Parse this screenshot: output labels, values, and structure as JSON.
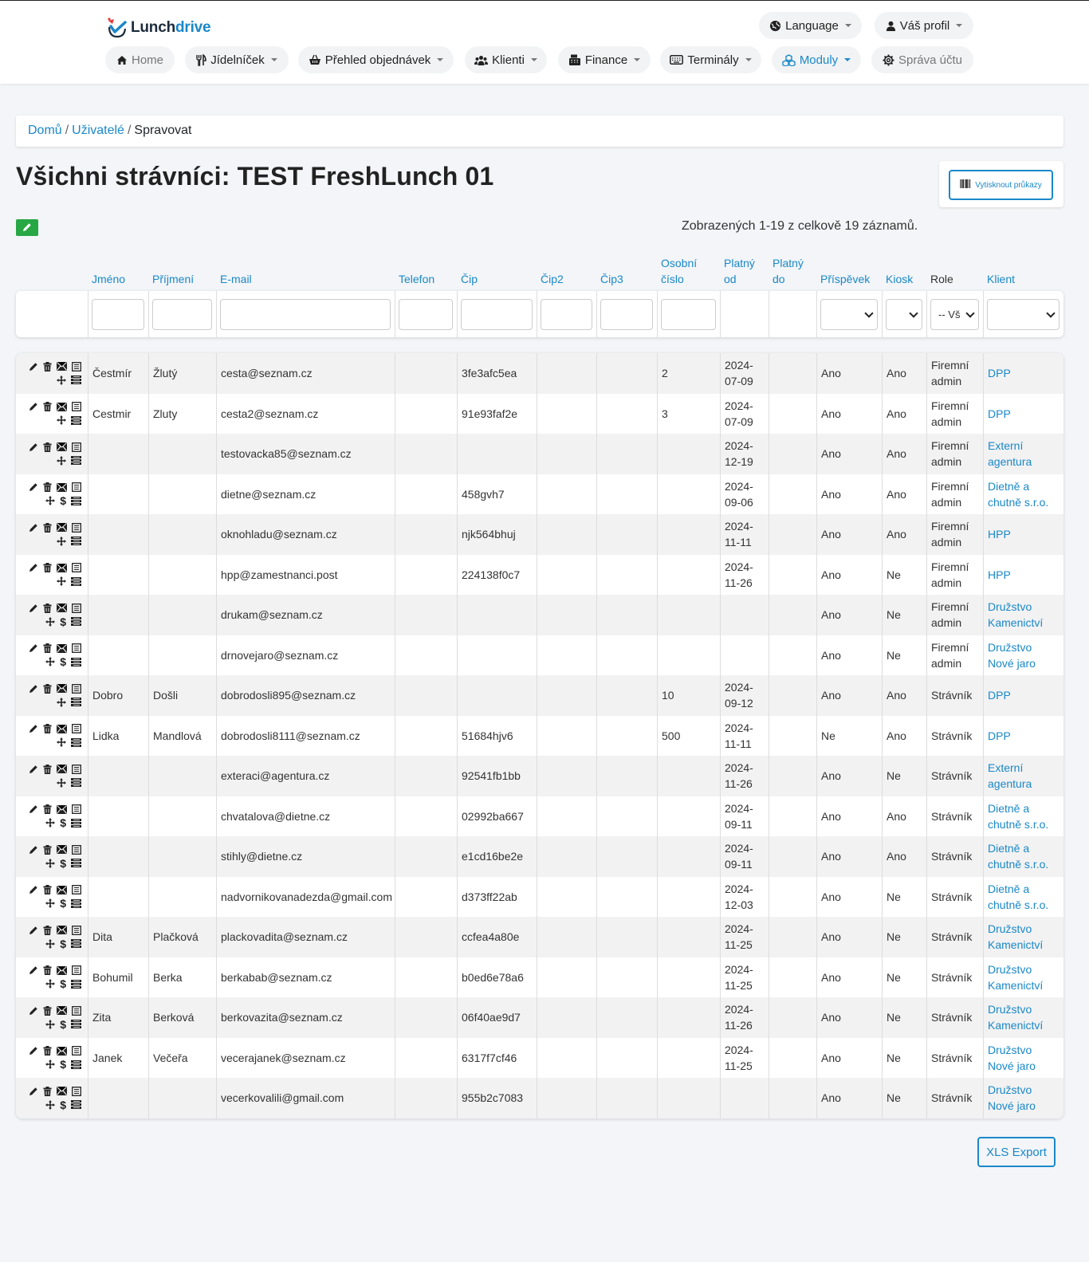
{
  "brand": {
    "name_part1": "Lunch",
    "name_part2": "drive"
  },
  "top_right": {
    "language": "Language",
    "profile": "Váš profil"
  },
  "nav": [
    {
      "label": "Home",
      "icon": "home-icon",
      "dropdown": false,
      "style": "muted"
    },
    {
      "label": "Jídelníček",
      "icon": "utensils-icon",
      "dropdown": true,
      "style": "normal"
    },
    {
      "label": "Přehled objednávek",
      "icon": "basket-icon",
      "dropdown": true,
      "style": "normal"
    },
    {
      "label": "Klienti",
      "icon": "users-icon",
      "dropdown": true,
      "style": "normal"
    },
    {
      "label": "Finance",
      "icon": "cash-register-icon",
      "dropdown": true,
      "style": "normal"
    },
    {
      "label": "Terminály",
      "icon": "keyboard-icon",
      "dropdown": true,
      "style": "normal"
    },
    {
      "label": "Moduly",
      "icon": "cubes-icon",
      "dropdown": true,
      "style": "accent"
    },
    {
      "label": "Správa účtu",
      "icon": "gear-icon",
      "dropdown": false,
      "style": "muted"
    }
  ],
  "breadcrumb": {
    "home": "Domů",
    "users": "Uživatelé",
    "current": "Spravovat",
    "separator": "/"
  },
  "page": {
    "title": "Všichni strávníci: TEST FreshLunch 01",
    "print_button": "Vytisknout průkazy",
    "summary": "Zobrazených 1-19 z celkově 19 záznamů.",
    "xls_export": "XLS Export"
  },
  "columns": [
    {
      "key": "first_name",
      "label": "Jméno",
      "sortable": true
    },
    {
      "key": "last_name",
      "label": "Příjmení",
      "sortable": true
    },
    {
      "key": "email",
      "label": "E-mail",
      "sortable": true
    },
    {
      "key": "phone",
      "label": "Telefon",
      "sortable": true
    },
    {
      "key": "chip",
      "label": "Čip",
      "sortable": true
    },
    {
      "key": "chip2",
      "label": "Čip2",
      "sortable": true
    },
    {
      "key": "chip3",
      "label": "Čip3",
      "sortable": true
    },
    {
      "key": "personal_no",
      "label": "Osobní číslo",
      "sortable": true
    },
    {
      "key": "valid_from",
      "label": "Platný od",
      "sortable": true
    },
    {
      "key": "valid_to",
      "label": "Platný do",
      "sortable": true
    },
    {
      "key": "contribution",
      "label": "Příspěvek",
      "sortable": true
    },
    {
      "key": "kiosk",
      "label": "Kiosk",
      "sortable": true
    },
    {
      "key": "role",
      "label": "Role",
      "sortable": false
    },
    {
      "key": "client",
      "label": "Klient",
      "sortable": true
    }
  ],
  "filters": {
    "role_selected": "-- Vš"
  },
  "rows": [
    {
      "first_name": "Čestmír",
      "last_name": "Žlutý",
      "email": "cesta@seznam.cz",
      "phone": "",
      "chip": "3fe3afc5ea",
      "chip2": "",
      "chip3": "",
      "personal_no": "2",
      "valid_from": "2024-07-09",
      "valid_to": "",
      "contribution": "Ano",
      "kiosk": "Ano",
      "role": "Firemní admin",
      "client": "DPP",
      "has_dollar": false
    },
    {
      "first_name": "Cestmir",
      "last_name": "Zluty",
      "email": "cesta2@seznam.cz",
      "phone": "",
      "chip": "91e93faf2e",
      "chip2": "",
      "chip3": "",
      "personal_no": "3",
      "valid_from": "2024-07-09",
      "valid_to": "",
      "contribution": "Ano",
      "kiosk": "Ano",
      "role": "Firemní admin",
      "client": "DPP",
      "has_dollar": false
    },
    {
      "first_name": "",
      "last_name": "",
      "email": "testovacka85@seznam.cz",
      "phone": "",
      "chip": "",
      "chip2": "",
      "chip3": "",
      "personal_no": "",
      "valid_from": "2024-12-19",
      "valid_to": "",
      "contribution": "Ano",
      "kiosk": "Ano",
      "role": "Firemní admin",
      "client": "Externí agentura",
      "has_dollar": false
    },
    {
      "first_name": "",
      "last_name": "",
      "email": "dietne@seznam.cz",
      "phone": "",
      "chip": "458gvh7",
      "chip2": "",
      "chip3": "",
      "personal_no": "",
      "valid_from": "2024-09-06",
      "valid_to": "",
      "contribution": "Ano",
      "kiosk": "Ano",
      "role": "Firemní admin",
      "client": "Dietně a chutně s.r.o.",
      "has_dollar": true
    },
    {
      "first_name": "",
      "last_name": "",
      "email": "oknohladu@seznam.cz",
      "phone": "",
      "chip": "njk564bhuj",
      "chip2": "",
      "chip3": "",
      "personal_no": "",
      "valid_from": "2024-11-11",
      "valid_to": "",
      "contribution": "Ano",
      "kiosk": "Ano",
      "role": "Firemní admin",
      "client": "HPP",
      "has_dollar": false
    },
    {
      "first_name": "",
      "last_name": "",
      "email": "hpp@zamestnanci.post",
      "phone": "",
      "chip": "224138f0c7",
      "chip2": "",
      "chip3": "",
      "personal_no": "",
      "valid_from": "2024-11-26",
      "valid_to": "",
      "contribution": "Ano",
      "kiosk": "Ne",
      "role": "Firemní admin",
      "client": "HPP",
      "has_dollar": false
    },
    {
      "first_name": "",
      "last_name": "",
      "email": "drukam@seznam.cz",
      "phone": "",
      "chip": "",
      "chip2": "",
      "chip3": "",
      "personal_no": "",
      "valid_from": "",
      "valid_to": "",
      "contribution": "Ano",
      "kiosk": "Ne",
      "role": "Firemní admin",
      "client": "Družstvo Kamenictví",
      "has_dollar": true
    },
    {
      "first_name": "",
      "last_name": "",
      "email": "drnovejaro@seznam.cz",
      "phone": "",
      "chip": "",
      "chip2": "",
      "chip3": "",
      "personal_no": "",
      "valid_from": "",
      "valid_to": "",
      "contribution": "Ano",
      "kiosk": "Ne",
      "role": "Firemní admin",
      "client": "Družstvo Nové jaro",
      "has_dollar": true
    },
    {
      "first_name": "Dobro",
      "last_name": "Došli",
      "email": "dobrodosli895@seznam.cz",
      "phone": "",
      "chip": "",
      "chip2": "",
      "chip3": "",
      "personal_no": "10",
      "valid_from": "2024-09-12",
      "valid_to": "",
      "contribution": "Ano",
      "kiosk": "Ano",
      "role": "Strávník",
      "client": "DPP",
      "has_dollar": false
    },
    {
      "first_name": "Lidka",
      "last_name": "Mandlová",
      "email": "dobrodosli8111@seznam.cz",
      "phone": "",
      "chip": "51684hjv6",
      "chip2": "",
      "chip3": "",
      "personal_no": "500",
      "valid_from": "2024-11-11",
      "valid_to": "",
      "contribution": "Ne",
      "kiosk": "Ano",
      "role": "Strávník",
      "client": "DPP",
      "has_dollar": false
    },
    {
      "first_name": "",
      "last_name": "",
      "email": "exteraci@agentura.cz",
      "phone": "",
      "chip": "92541fb1bb",
      "chip2": "",
      "chip3": "",
      "personal_no": "",
      "valid_from": "2024-11-26",
      "valid_to": "",
      "contribution": "Ano",
      "kiosk": "Ne",
      "role": "Strávník",
      "client": "Externí agentura",
      "has_dollar": false
    },
    {
      "first_name": "",
      "last_name": "",
      "email": "chvatalova@dietne.cz",
      "phone": "",
      "chip": "02992ba667",
      "chip2": "",
      "chip3": "",
      "personal_no": "",
      "valid_from": "2024-09-11",
      "valid_to": "",
      "contribution": "Ano",
      "kiosk": "Ano",
      "role": "Strávník",
      "client": "Dietně a chutně s.r.o.",
      "has_dollar": true
    },
    {
      "first_name": "",
      "last_name": "",
      "email": "stihly@dietne.cz",
      "phone": "",
      "chip": "e1cd16be2e",
      "chip2": "",
      "chip3": "",
      "personal_no": "",
      "valid_from": "2024-09-11",
      "valid_to": "",
      "contribution": "Ano",
      "kiosk": "Ano",
      "role": "Strávník",
      "client": "Dietně a chutně s.r.o.",
      "has_dollar": true
    },
    {
      "first_name": "",
      "last_name": "",
      "email": "nadvornikovanadezda@gmail.com",
      "phone": "",
      "chip": "d373ff22ab",
      "chip2": "",
      "chip3": "",
      "personal_no": "",
      "valid_from": "2024-12-03",
      "valid_to": "",
      "contribution": "Ano",
      "kiosk": "Ne",
      "role": "Strávník",
      "client": "Dietně a chutně s.r.o.",
      "has_dollar": true
    },
    {
      "first_name": "Dita",
      "last_name": "Plačková",
      "email": "plackovadita@seznam.cz",
      "phone": "",
      "chip": "ccfea4a80e",
      "chip2": "",
      "chip3": "",
      "personal_no": "",
      "valid_from": "2024-11-25",
      "valid_to": "",
      "contribution": "Ano",
      "kiosk": "Ne",
      "role": "Strávník",
      "client": "Družstvo Kamenictví",
      "has_dollar": true
    },
    {
      "first_name": "Bohumil",
      "last_name": "Berka",
      "email": "berkabab@seznam.cz",
      "phone": "",
      "chip": "b0ed6e78a6",
      "chip2": "",
      "chip3": "",
      "personal_no": "",
      "valid_from": "2024-11-25",
      "valid_to": "",
      "contribution": "Ano",
      "kiosk": "Ne",
      "role": "Strávník",
      "client": "Družstvo Kamenictví",
      "has_dollar": true
    },
    {
      "first_name": "Zita",
      "last_name": "Berková",
      "email": "berkovazita@seznam.cz",
      "phone": "",
      "chip": "06f40ae9d7",
      "chip2": "",
      "chip3": "",
      "personal_no": "",
      "valid_from": "2024-11-26",
      "valid_to": "",
      "contribution": "Ano",
      "kiosk": "Ne",
      "role": "Strávník",
      "client": "Družstvo Kamenictví",
      "has_dollar": true
    },
    {
      "first_name": "Janek",
      "last_name": "Večeřa",
      "email": "vecerajanek@seznam.cz",
      "phone": "",
      "chip": "6317f7cf46",
      "chip2": "",
      "chip3": "",
      "personal_no": "",
      "valid_from": "2024-11-25",
      "valid_to": "",
      "contribution": "Ano",
      "kiosk": "Ne",
      "role": "Strávník",
      "client": "Družstvo Nové jaro",
      "has_dollar": true
    },
    {
      "first_name": "",
      "last_name": "",
      "email": "vecerkovalili@gmail.com",
      "phone": "",
      "chip": "955b2c7083",
      "chip2": "",
      "chip3": "",
      "personal_no": "",
      "valid_from": "",
      "valid_to": "",
      "contribution": "Ano",
      "kiosk": "Ne",
      "role": "Strávník",
      "client": "Družstvo Nové jaro",
      "has_dollar": true
    }
  ],
  "colors": {
    "accent": "#1a88c9",
    "edit_button": "#28a745",
    "stripe": "#f2f2f2"
  }
}
